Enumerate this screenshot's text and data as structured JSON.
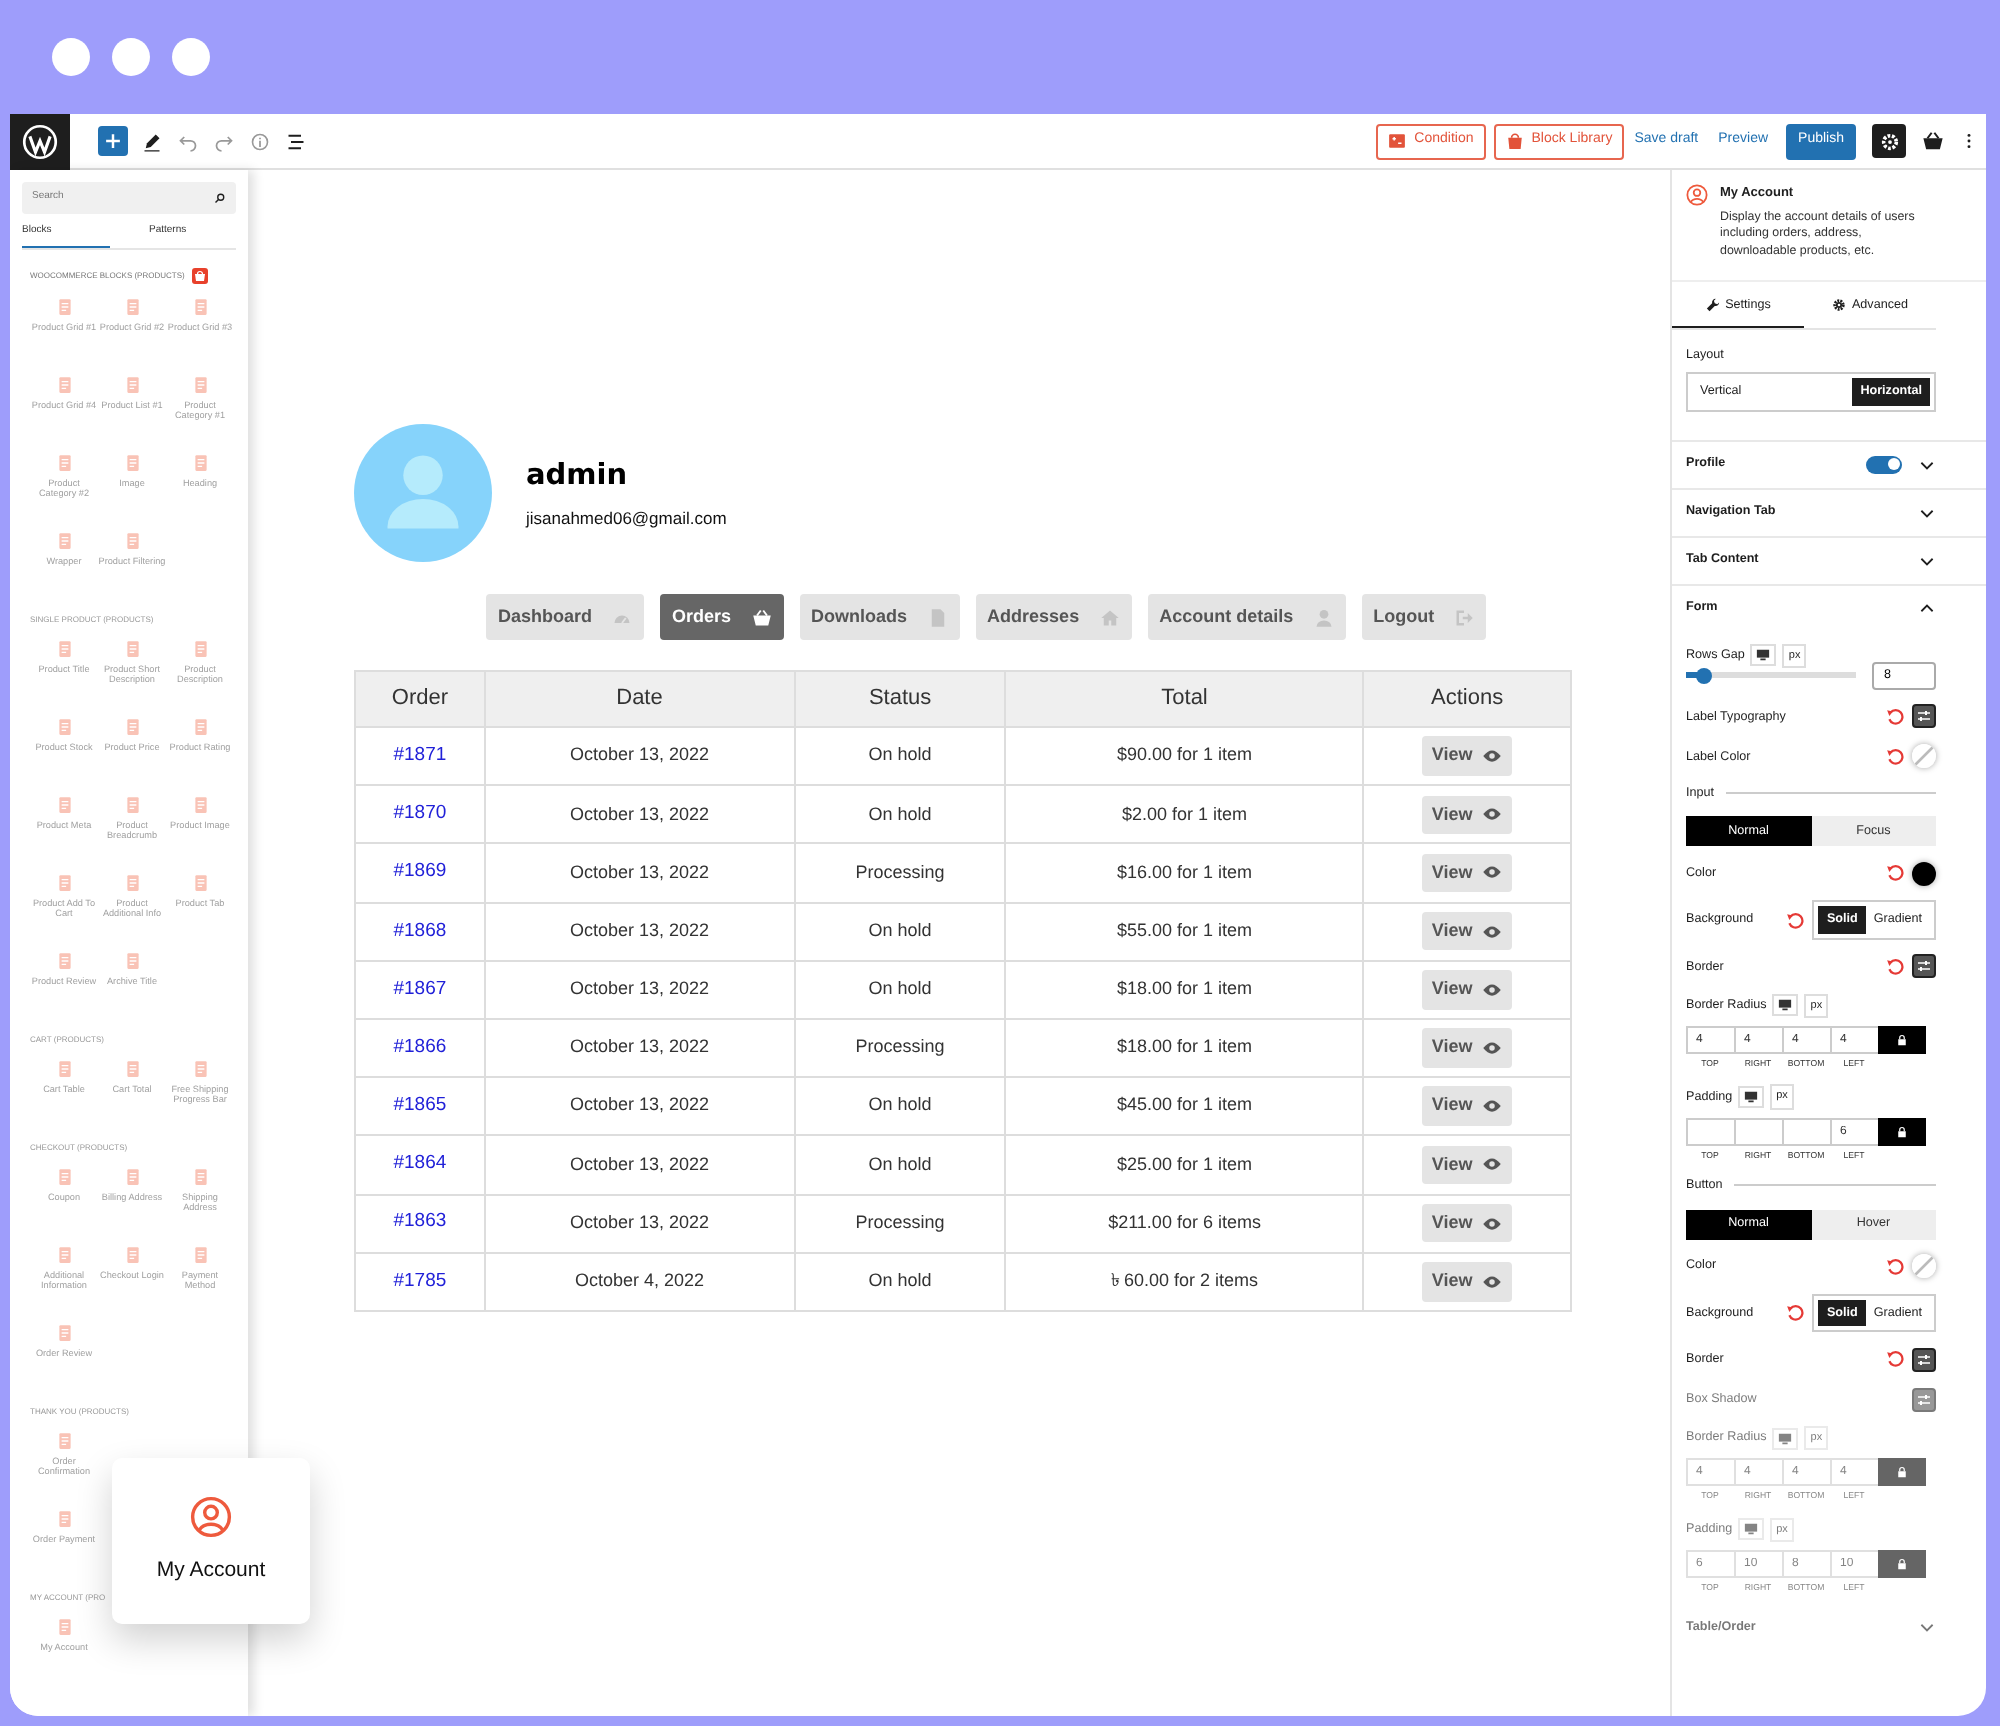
{
  "toolbar": {
    "actions": [
      {
        "kind": "outline",
        "label": "Condition"
      },
      {
        "kind": "outline",
        "label": "Block Library"
      },
      {
        "kind": "link",
        "label": "Save draft"
      },
      {
        "kind": "link",
        "label": "Preview"
      },
      {
        "kind": "primary",
        "label": "Publish"
      }
    ]
  },
  "sidebar": {
    "search": {
      "placeholder": "Search"
    },
    "tabs": [
      {
        "label": "Blocks",
        "selected": true
      },
      {
        "label": "Patterns",
        "selected": false
      }
    ],
    "sections": [
      {
        "title": "WOOCOMMERCE BLOCKS (PRODUCTS)",
        "badge": true,
        "items": [
          "Product Grid #1",
          "Product Grid #2",
          "Product Grid #3",
          "Product Grid #4",
          "Product List #1",
          "Product Category #1",
          "Product Category #2",
          "Image",
          "Heading",
          "Wrapper",
          "Product Filtering"
        ]
      },
      {
        "title": "SINGLE PRODUCT (PRODUCTS)",
        "badge": false,
        "items": [
          "Product Title",
          "Product Short Description",
          "Product Description",
          "Product Stock",
          "Product Price",
          "Product Rating",
          "Product Meta",
          "Product Breadcrumb",
          "Product Image",
          "Product Add To Cart",
          "Product Additional Info",
          "Product Tab",
          "Product Review",
          "Archive Title"
        ]
      },
      {
        "title": "CART (PRODUCTS)",
        "badge": false,
        "items": [
          "Cart Table",
          "Cart Total",
          "Free Shipping Progress Bar"
        ]
      },
      {
        "title": "CHECKOUT (PRODUCTS)",
        "badge": false,
        "items": [
          "Coupon",
          "Billing Address",
          "Shipping Address",
          "Additional Information",
          "Checkout Login",
          "Payment Method",
          "Order Review"
        ]
      },
      {
        "title": "THANK YOU (PRODUCTS)",
        "badge": false,
        "items": [
          "Order Confirmation",
          "Order Payment"
        ]
      },
      {
        "title": "MY ACCOUNT (PRO",
        "badge": false,
        "items": [
          "My Account"
        ]
      }
    ]
  },
  "floating_card": {
    "label": "My Account"
  },
  "profile": {
    "name": "admin",
    "email": "jisanahmed06@gmail.com"
  },
  "nav_tabs": [
    {
      "label": "Dashboard",
      "selected": false
    },
    {
      "label": "Orders",
      "selected": true
    },
    {
      "label": "Downloads",
      "selected": false
    },
    {
      "label": "Addresses",
      "selected": false
    },
    {
      "label": "Account details",
      "selected": false
    },
    {
      "label": "Logout",
      "selected": false
    }
  ],
  "orders_table": {
    "columns": [
      "Order",
      "Date",
      "Status",
      "Total",
      "Actions"
    ],
    "rows": [
      {
        "order": "#1871",
        "date": "October 13, 2022",
        "status": "On hold",
        "total": "$90.00 for 1 item",
        "action": "View"
      },
      {
        "order": "#1870",
        "date": "October 13, 2022",
        "status": "On hold",
        "total": "$2.00 for 1 item",
        "action": "View"
      },
      {
        "order": "#1869",
        "date": "October 13, 2022",
        "status": "Processing",
        "total": "$16.00 for 1 item",
        "action": "View"
      },
      {
        "order": "#1868",
        "date": "October 13, 2022",
        "status": "On hold",
        "total": "$55.00 for 1 item",
        "action": "View"
      },
      {
        "order": "#1867",
        "date": "October 13, 2022",
        "status": "On hold",
        "total": "$18.00 for 1 item",
        "action": "View"
      },
      {
        "order": "#1866",
        "date": "October 13, 2022",
        "status": "Processing",
        "total": "$18.00 for 1 item",
        "action": "View"
      },
      {
        "order": "#1865",
        "date": "October 13, 2022",
        "status": "On hold",
        "total": "$45.00 for 1 item",
        "action": "View"
      },
      {
        "order": "#1864",
        "date": "October 13, 2022",
        "status": "On hold",
        "total": "$25.00 for 1 item",
        "action": "View"
      },
      {
        "order": "#1863",
        "date": "October 13, 2022",
        "status": "Processing",
        "total": "$211.00 for 6 items",
        "action": "View"
      },
      {
        "order": "#1785",
        "date": "October 4, 2022",
        "status": "On hold",
        "total": "৳ 60.00 for 2 items",
        "action": "View"
      }
    ]
  },
  "inspector": {
    "block": {
      "title": "My Account",
      "description": "Display the account details of users including orders, address, downloadable products, etc."
    },
    "tabs": [
      {
        "label": "Settings",
        "selected": true
      },
      {
        "label": "Advanced",
        "selected": false
      }
    ],
    "layout": {
      "label": "Layout",
      "options": [
        {
          "label": "Vertical",
          "selected": false
        },
        {
          "label": "Horizontal",
          "selected": true
        }
      ]
    },
    "sections": [
      {
        "title": "Profile",
        "expanded": false,
        "toggle": {
          "on": true
        }
      },
      {
        "title": "Navigation Tab",
        "expanded": false
      },
      {
        "title": "Tab Content",
        "expanded": false
      },
      {
        "title": "Form",
        "expanded": true
      }
    ],
    "form_controls": [
      {
        "kind": "slider",
        "label": "Rows Gap",
        "unit": "px",
        "level": 0.1,
        "value": "8",
        "dimmed": false
      },
      {
        "kind": "tool",
        "label": "Label Typography",
        "reset": true,
        "dimmed": false
      },
      {
        "kind": "color",
        "label": "Label Color",
        "reset": true,
        "dimmed": false
      },
      {
        "kind": "heading",
        "label": "Input",
        "dimmed": false
      },
      {
        "kind": "switch",
        "options": [
          {
            "label": "Normal",
            "selected": true
          },
          {
            "label": "Focus",
            "selected": false
          }
        ],
        "dimmed": false
      },
      {
        "kind": "color",
        "label": "Color",
        "reset": true,
        "color": "#000000",
        "dimmed": false
      },
      {
        "kind": "fill",
        "label": "Background",
        "reset": true,
        "options": [
          {
            "label": "Solid",
            "selected": true
          },
          {
            "label": "Gradient",
            "selected": false
          }
        ],
        "dimmed": false
      },
      {
        "kind": "tool",
        "label": "Border",
        "reset": true,
        "dimmed": false
      },
      {
        "kind": "dimensions",
        "label": "Border Radius",
        "unit": "px",
        "fields": [
          {
            "side": "TOP",
            "value": "4"
          },
          {
            "side": "RIGHT",
            "value": "4"
          },
          {
            "side": "BOTTOM",
            "value": "4"
          },
          {
            "side": "LEFT",
            "value": "4"
          }
        ],
        "dimmed": false
      },
      {
        "kind": "dimensions",
        "label": "Padding",
        "unit": "px",
        "fields": [
          {
            "side": "TOP"
          },
          {
            "side": "RIGHT"
          },
          {
            "side": "BOTTOM"
          },
          {
            "side": "LEFT",
            "value": "6"
          }
        ],
        "dimmed": false
      },
      {
        "kind": "heading",
        "label": "Button",
        "dimmed": false
      },
      {
        "kind": "switch",
        "options": [
          {
            "label": "Normal",
            "selected": true
          },
          {
            "label": "Hover",
            "selected": false
          }
        ],
        "dimmed": false
      },
      {
        "kind": "color",
        "label": "Color",
        "reset": true,
        "dimmed": false
      },
      {
        "kind": "fill",
        "label": "Background",
        "reset": true,
        "options": [
          {
            "label": "Solid",
            "selected": true
          },
          {
            "label": "Gradient",
            "selected": false
          }
        ],
        "dimmed": false
      },
      {
        "kind": "tool",
        "label": "Border",
        "reset": true,
        "dimmed": false
      },
      {
        "kind": "tool",
        "label": "Box Shadow",
        "reset": false,
        "dimmed": true
      },
      {
        "kind": "dimensions",
        "label": "Border Radius",
        "unit": "px",
        "fields": [
          {
            "side": "TOP",
            "value": "4"
          },
          {
            "side": "RIGHT",
            "value": "4"
          },
          {
            "side": "BOTTOM",
            "value": "4"
          },
          {
            "side": "LEFT",
            "value": "4"
          }
        ],
        "dimmed": true
      },
      {
        "kind": "dimensions",
        "label": "Padding",
        "unit": "px",
        "fields": [
          {
            "side": "TOP",
            "value": "6"
          },
          {
            "side": "RIGHT",
            "value": "10"
          },
          {
            "side": "BOTTOM",
            "value": "8"
          },
          {
            "side": "LEFT",
            "value": "10"
          }
        ],
        "dimmed": true
      }
    ],
    "footer_section": {
      "title": "Table/Order",
      "expanded": false,
      "dimmed": true
    }
  }
}
